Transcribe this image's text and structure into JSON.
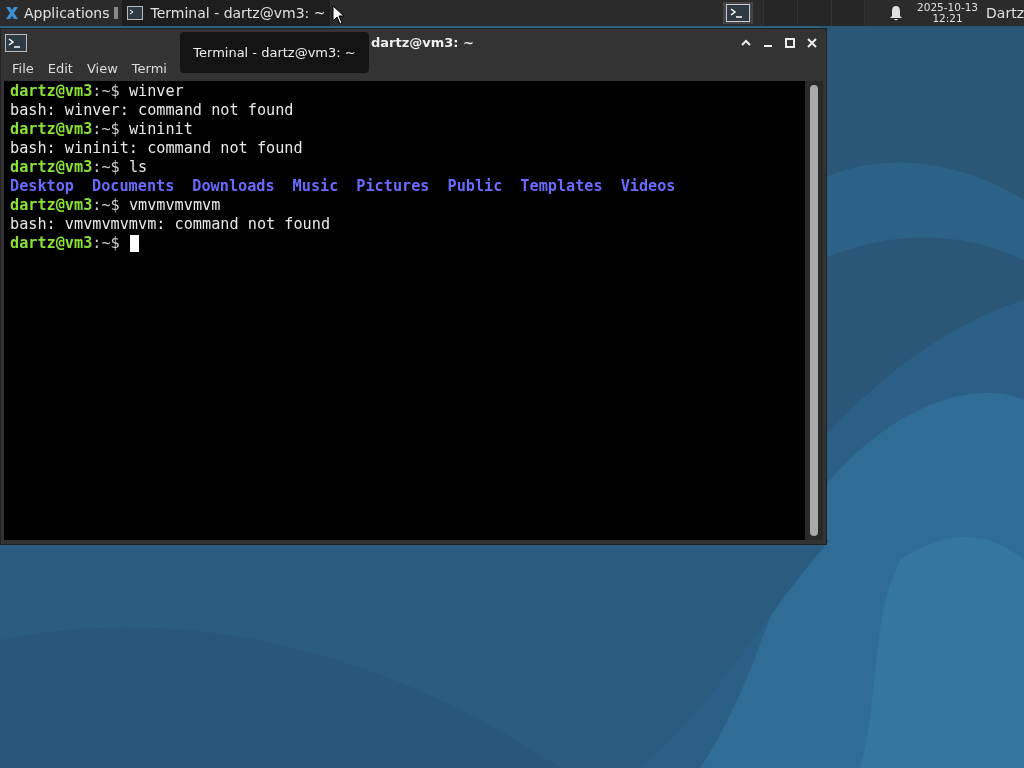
{
  "panel": {
    "menu_label": "Applications",
    "tasks": [
      {
        "title": "Terminal - dartz@vm3: ~",
        "selected": true
      }
    ],
    "clock": {
      "date": "2025-10-13",
      "time": "12:21"
    },
    "user": "Dartz"
  },
  "window": {
    "title": "dartz@vm3: ~",
    "menu": [
      "File",
      "Edit",
      "View",
      "Termi"
    ],
    "tooltip": "Terminal - dartz@vm3: ~",
    "lines": [
      {
        "kind": "prompt",
        "user": "dartz@vm3",
        "path": ":~$",
        "command": "winver"
      },
      {
        "kind": "output",
        "text": "bash: winver: command not found"
      },
      {
        "kind": "prompt",
        "user": "dartz@vm3",
        "path": ":~$",
        "command": "wininit"
      },
      {
        "kind": "output",
        "text": "bash: wininit: command not found"
      },
      {
        "kind": "prompt",
        "user": "dartz@vm3",
        "path": ":~$",
        "command": "ls"
      },
      {
        "kind": "listing",
        "items": [
          "Desktop",
          "Documents",
          "Downloads",
          "Music",
          "Pictures",
          "Public",
          "Templates",
          "Videos"
        ]
      },
      {
        "kind": "prompt",
        "user": "dartz@vm3",
        "path": ":~$",
        "command": "vmvmvmvmvm"
      },
      {
        "kind": "output",
        "text": "bash: vmvmvmvmvm: command not found"
      },
      {
        "kind": "prompt",
        "user": "dartz@vm3",
        "path": ":~$",
        "cursor": true
      }
    ]
  }
}
